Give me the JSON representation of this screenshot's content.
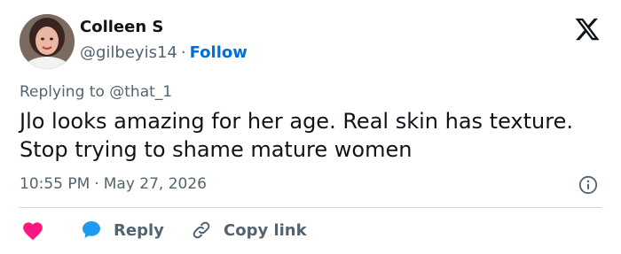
{
  "author": {
    "name": "Colleen S",
    "handle": "@gilbeyis14",
    "separator": "·",
    "follow_label": "Follow"
  },
  "reply_context": {
    "prefix": "Replying to",
    "mention": "@that_1"
  },
  "tweet": {
    "text": "Jlo looks amazing for her age. Real skin has texture. Stop trying to shame mature women",
    "time": "10:55 PM",
    "separator": "·",
    "date": "May 27, 2026"
  },
  "actions": {
    "reply_label": "Reply",
    "copy_link_label": "Copy link"
  },
  "icons": {
    "logo": "x-logo-icon",
    "info": "info-icon",
    "like": "heart-icon",
    "reply": "speech-bubble-icon",
    "copy": "link-icon"
  },
  "colors": {
    "text": "#0f1419",
    "secondary": "#536471",
    "link": "#006fd6",
    "heart": "#f91880",
    "reply_bubble": "#1d9bf0",
    "divider": "#cfd9de"
  }
}
